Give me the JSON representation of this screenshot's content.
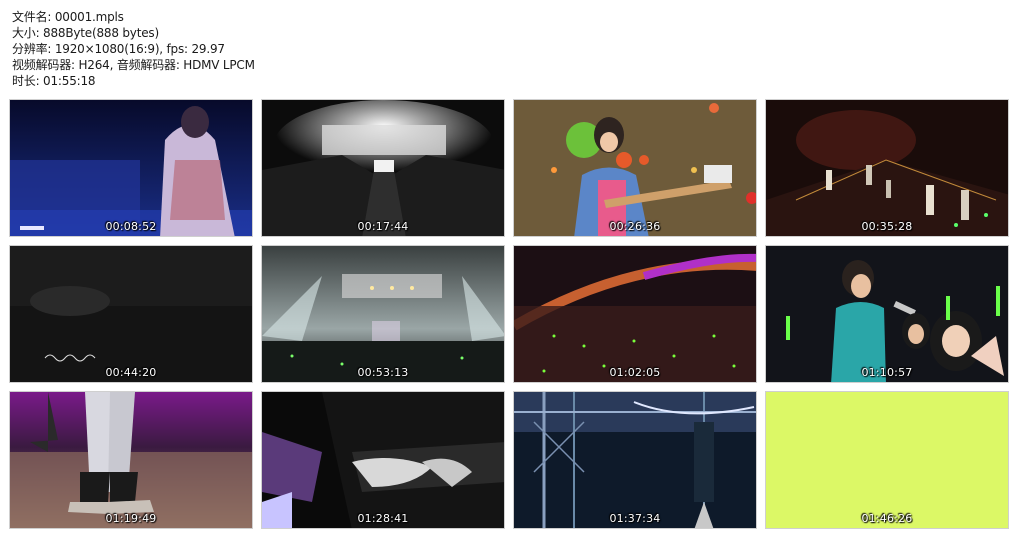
{
  "info": {
    "filename": "文件名: 00001.mpls",
    "size": "大小: 888Byte(888 bytes)",
    "resolution": "分辨率: 1920×1080(16:9), fps: 29.97",
    "codecs": "视频解码器: H264, 音频解码器: HDMV LPCM",
    "duration": "时长: 01:55:18"
  },
  "thumbnails": [
    {
      "time": "00:08:52",
      "scene": "performer-back-blue-stage"
    },
    {
      "time": "00:17:44",
      "scene": "monochrome-arena-stage"
    },
    {
      "time": "00:26:36",
      "scene": "guitarist-bokeh-background"
    },
    {
      "time": "00:35:28",
      "scene": "dark-stage-band"
    },
    {
      "time": "00:44:20",
      "scene": "dark-stage-handwriting"
    },
    {
      "time": "00:53:13",
      "scene": "arena-wide-lights"
    },
    {
      "time": "01:02:05",
      "scene": "crowd-green-lights"
    },
    {
      "time": "01:10:57",
      "scene": "singer-with-fans"
    },
    {
      "time": "01:19:49",
      "scene": "boots-on-stage"
    },
    {
      "time": "01:28:41",
      "scene": "hands-on-piano"
    },
    {
      "time": "01:37:34",
      "scene": "stage-truss-backstage"
    },
    {
      "time": "01:46:26",
      "scene": "yellow-green-frame"
    }
  ],
  "colors": {
    "frame_border": "#cfcfcf",
    "timestamp": "#ffffff",
    "page_background": "#ffffff"
  }
}
